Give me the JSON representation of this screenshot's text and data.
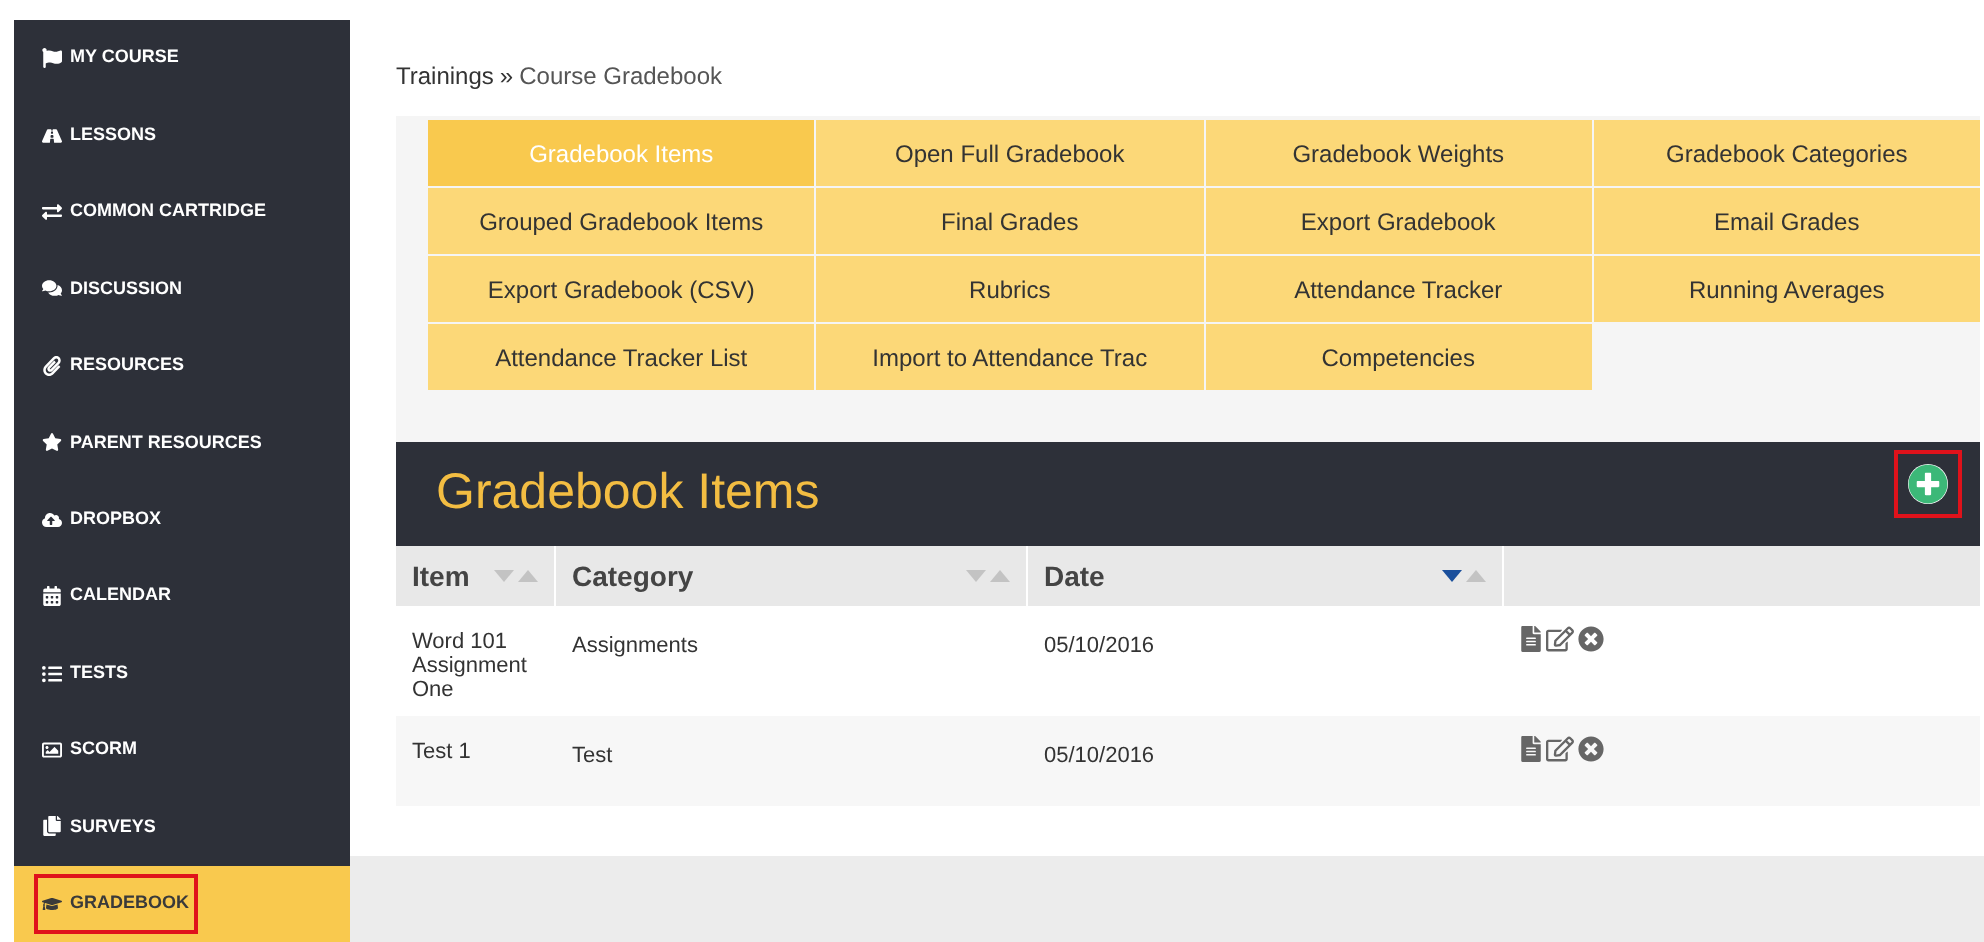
{
  "sidebar": {
    "items": [
      {
        "label": "MY COURSE",
        "selected": false,
        "highlighted": false
      },
      {
        "label": "LESSONS",
        "selected": false,
        "highlighted": false
      },
      {
        "label": "COMMON CARTRIDGE",
        "selected": false,
        "highlighted": false
      },
      {
        "label": "DISCUSSION",
        "selected": false,
        "highlighted": false
      },
      {
        "label": "RESOURCES",
        "selected": false,
        "highlighted": false
      },
      {
        "label": "PARENT RESOURCES",
        "selected": false,
        "highlighted": false
      },
      {
        "label": "DROPBOX",
        "selected": false,
        "highlighted": false
      },
      {
        "label": "CALENDAR",
        "selected": false,
        "highlighted": false
      },
      {
        "label": "TESTS",
        "selected": false,
        "highlighted": false
      },
      {
        "label": "SCORM",
        "selected": false,
        "highlighted": false
      },
      {
        "label": "SURVEYS",
        "selected": false,
        "highlighted": false
      },
      {
        "label": "GRADEBOOK",
        "selected": true,
        "highlighted": true
      }
    ]
  },
  "breadcrumb": {
    "parent": "Trainings",
    "separator": "»",
    "current": "Course Gradebook"
  },
  "menu": [
    {
      "label": "Gradebook Items",
      "selected": true
    },
    {
      "label": "Open Full Gradebook",
      "selected": false
    },
    {
      "label": "Gradebook Weights",
      "selected": false
    },
    {
      "label": "Gradebook Categories",
      "selected": false
    },
    {
      "label": "Grouped Gradebook Items",
      "selected": false
    },
    {
      "label": "Final Grades",
      "selected": false
    },
    {
      "label": "Export Gradebook",
      "selected": false
    },
    {
      "label": "Email Grades",
      "selected": false
    },
    {
      "label": "Export Gradebook (CSV)",
      "selected": false
    },
    {
      "label": "Rubrics",
      "selected": false
    },
    {
      "label": "Attendance Tracker",
      "selected": false
    },
    {
      "label": "Running Averages",
      "selected": false
    },
    {
      "label": "Attendance Tracker List",
      "selected": false
    },
    {
      "label": "Import to Attendance Trac",
      "selected": false
    },
    {
      "label": "Competencies",
      "selected": false
    }
  ],
  "panel": {
    "title": "Gradebook Items",
    "add_button_highlighted": true
  },
  "table": {
    "columns": [
      {
        "label": "Item",
        "sorted": false
      },
      {
        "label": "Category",
        "sorted": false
      },
      {
        "label": "Date",
        "sorted": true
      }
    ],
    "rows": [
      {
        "item": "Word 101 Assignment One",
        "category": "Assignments",
        "date": "05/10/2016"
      },
      {
        "item": "Test 1",
        "category": "Test",
        "date": "05/10/2016"
      }
    ]
  }
}
